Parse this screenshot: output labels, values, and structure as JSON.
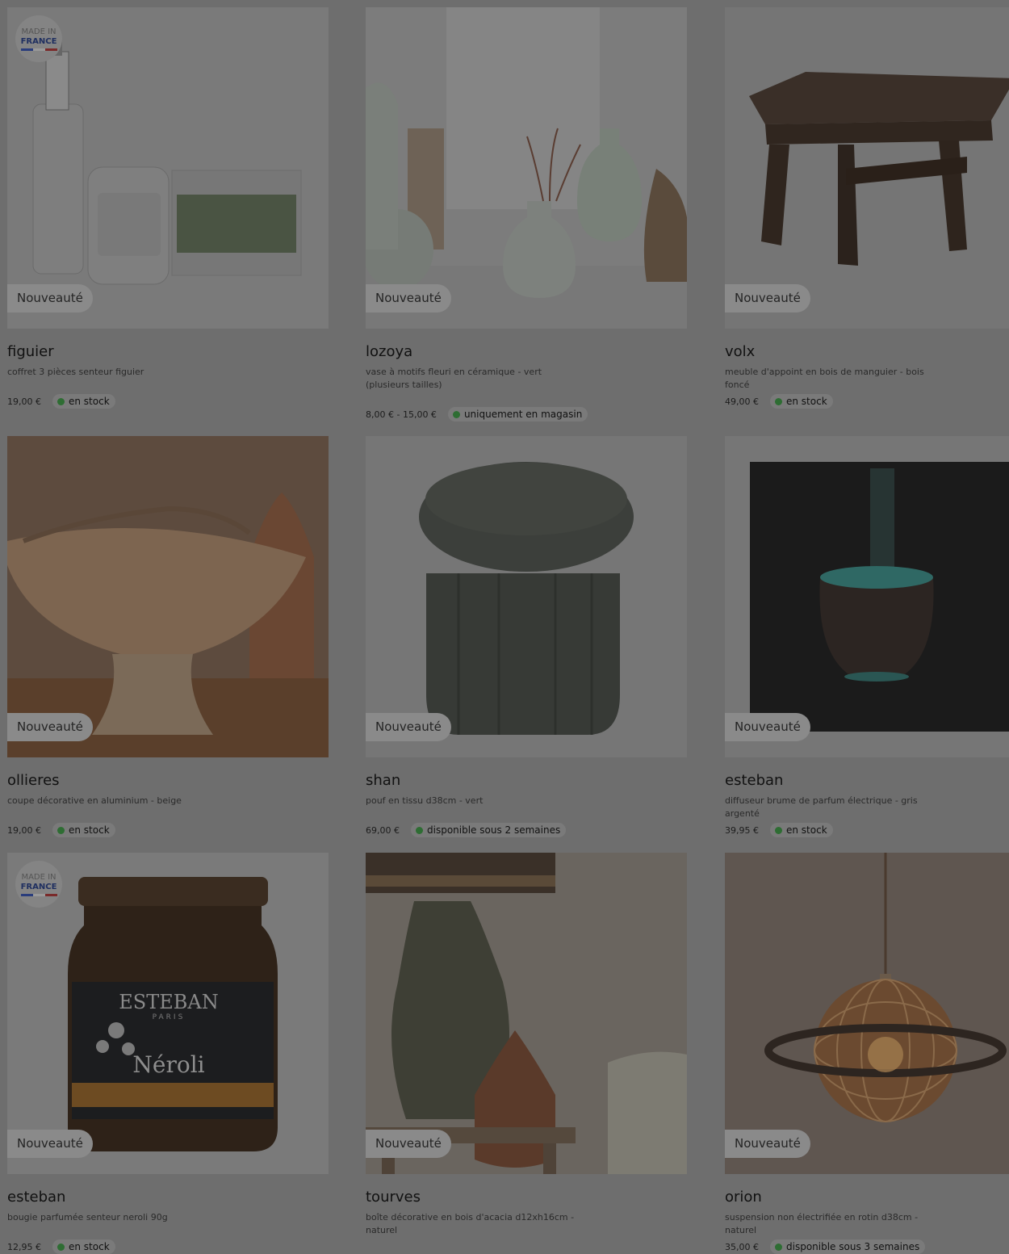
{
  "colors": {
    "overlay": "#6e6e6e",
    "stock_dot": "#2e6d33"
  },
  "products": [
    {
      "badge": "Nouveauté",
      "name": "figuier",
      "desc": "coffret 3 pièces senteur figuier",
      "price": "19,00 €",
      "stock": "en stock",
      "made_in_france": true,
      "made_line1": "MADE IN",
      "made_line2": "FRANCE"
    },
    {
      "badge": "Nouveauté",
      "name": "lozoya",
      "desc": "vase à motifs fleuri en céramique - vert (plusieurs tailles)",
      "price": "8,00 € - 15,00 €",
      "stock": "uniquement en magasin"
    },
    {
      "badge": "Nouveauté",
      "name": "volx",
      "desc": "meuble d'appoint en bois de manguier - bois foncé",
      "price": "49,00 €",
      "stock": "en stock"
    },
    {
      "badge": "Nouveauté",
      "name": "ollieres",
      "desc": "coupe décorative en aluminium - beige",
      "price": "19,00 €",
      "stock": "en stock"
    },
    {
      "badge": "Nouveauté",
      "name": "shan",
      "desc": "pouf en tissu d38cm - vert",
      "price": "69,00 €",
      "stock": "disponible sous 2 semaines"
    },
    {
      "badge": "Nouveauté",
      "name": "esteban",
      "desc": "diffuseur brume de parfum électrique - gris argenté",
      "price": "39,95 €",
      "stock": "en stock"
    },
    {
      "badge": "Nouveauté",
      "name": "esteban",
      "desc": "bougie parfumée senteur neroli 90g",
      "price": "12,95 €",
      "stock": "en stock",
      "made_in_france": true,
      "made_line1": "MADE IN",
      "made_line2": "FRANCE",
      "label_brand": "ESTEBAN",
      "label_city": "PARIS",
      "label_scent": "Néroli"
    },
    {
      "badge": "Nouveauté",
      "name": "tourves",
      "desc": "boîte décorative en bois d'acacia d12xh16cm - naturel",
      "price": "",
      "stock": ""
    },
    {
      "badge": "Nouveauté",
      "name": "orion",
      "desc": "suspension non électrifiée en rotin d38cm - naturel",
      "price": "35,00 €",
      "stock": "disponible sous 3 semaines"
    }
  ]
}
